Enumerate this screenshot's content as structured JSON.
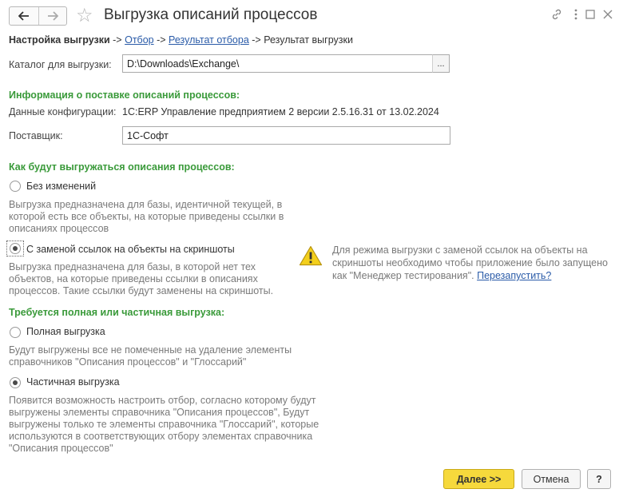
{
  "header": {
    "title": "Выгрузка описаний процессов",
    "back_icon": "arrow-left-icon",
    "forward_icon": "arrow-right-icon",
    "favorite_icon": "star-icon",
    "link_icon": "link-icon",
    "menu_icon": "more-vertical-icon",
    "maximize_icon": "maximize-icon",
    "close_icon": "close-icon"
  },
  "breadcrumb": {
    "current": "Настройка выгрузки",
    "sep1": " -> ",
    "step2": "Отбор",
    "sep2": " -> ",
    "step3": "Результат отбора",
    "sep3": " -> ",
    "step4": "Результат выгрузки"
  },
  "catalog": {
    "label": "Каталог для выгрузки:",
    "value": "D:\\Downloads\\Exchange\\",
    "select_label": "..."
  },
  "info": {
    "heading": "Информация о поставке описаний процессов:",
    "config_label": "Данные конфигурации:",
    "config_value": "1C:ERP Управление предприятием 2 версии 2.5.16.31 от 13.02.2024",
    "supplier_label": "Поставщик:",
    "supplier_value": "1С-Софт"
  },
  "mode": {
    "heading": "Как будут выгружаться описания процессов:",
    "opt1_label": "Без изменений",
    "opt1_desc": "Выгрузка предназначена для базы, идентичной текущей, в которой есть все объекты, на которые приведены ссылки в описаниях процессов",
    "opt2_label": "С заменой ссылок на объекты на скриншоты",
    "opt2_desc": "Выгрузка предназначена для базы, в которой нет тех объектов, на которые приведены ссылки в описаниях процессов. Такие ссылки будут заменены на скриншоты.",
    "selected": "opt2",
    "warning_icon": "warning-icon",
    "warning_text": "Для режима выгрузки с заменой ссылок на объекты на скриншоты необходимо чтобы приложение было запущено как \"Менеджер тестирования\". ",
    "warning_link": "Перезапустить?"
  },
  "scope": {
    "heading": "Требуется полная или частичная выгрузка:",
    "opt1_label": "Полная выгрузка",
    "opt1_desc": "Будут выгружены все не помеченные на удаление элементы справочников \"Описания процессов\" и \"Глоссарий\"",
    "opt2_label": "Частичная выгрузка",
    "opt2_desc": "Появится возможность настроить отбор, согласно которому будут выгружены элементы справочника \"Описания процессов\", Будут выгружены только те элементы справочника \"Глоссарий\", которые используются в соответствующих отбору элементах справочника \"Описания процессов\"",
    "selected": "opt2"
  },
  "footer": {
    "next_label": "Далее >>",
    "cancel_label": "Отмена",
    "help_label": "?"
  }
}
